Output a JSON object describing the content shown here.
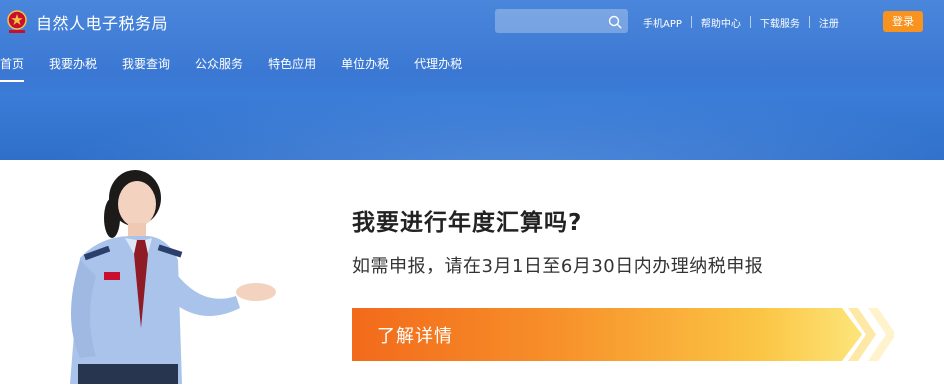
{
  "header": {
    "site_title": "自然人电子税务局",
    "search": {
      "placeholder": ""
    },
    "top_links": [
      "手机APP",
      "帮助中心",
      "下载服务",
      "注册"
    ],
    "login_label": "登录"
  },
  "nav": {
    "items": [
      {
        "label": "首页",
        "active": true
      },
      {
        "label": "我要办税",
        "active": false
      },
      {
        "label": "我要查询",
        "active": false
      },
      {
        "label": "公众服务",
        "active": false
      },
      {
        "label": "特色应用",
        "active": false
      },
      {
        "label": "单位办税",
        "active": false
      },
      {
        "label": "代理办税",
        "active": false
      }
    ]
  },
  "hero": {
    "heading": "我要进行年度汇算吗?",
    "subtext": "如需申报，请在3月1日至6月30日内办理纳税申报",
    "cta_label": "了解详情"
  },
  "colors": {
    "header_blue": "#3b78d3",
    "login_orange": "#f7931e",
    "cta_start": "#f26a1b",
    "cta_end": "#fde57a"
  },
  "icons": {
    "emblem": "tax-emblem-icon",
    "search": "search-icon",
    "cta_arrows": "chevron-right-icon"
  }
}
